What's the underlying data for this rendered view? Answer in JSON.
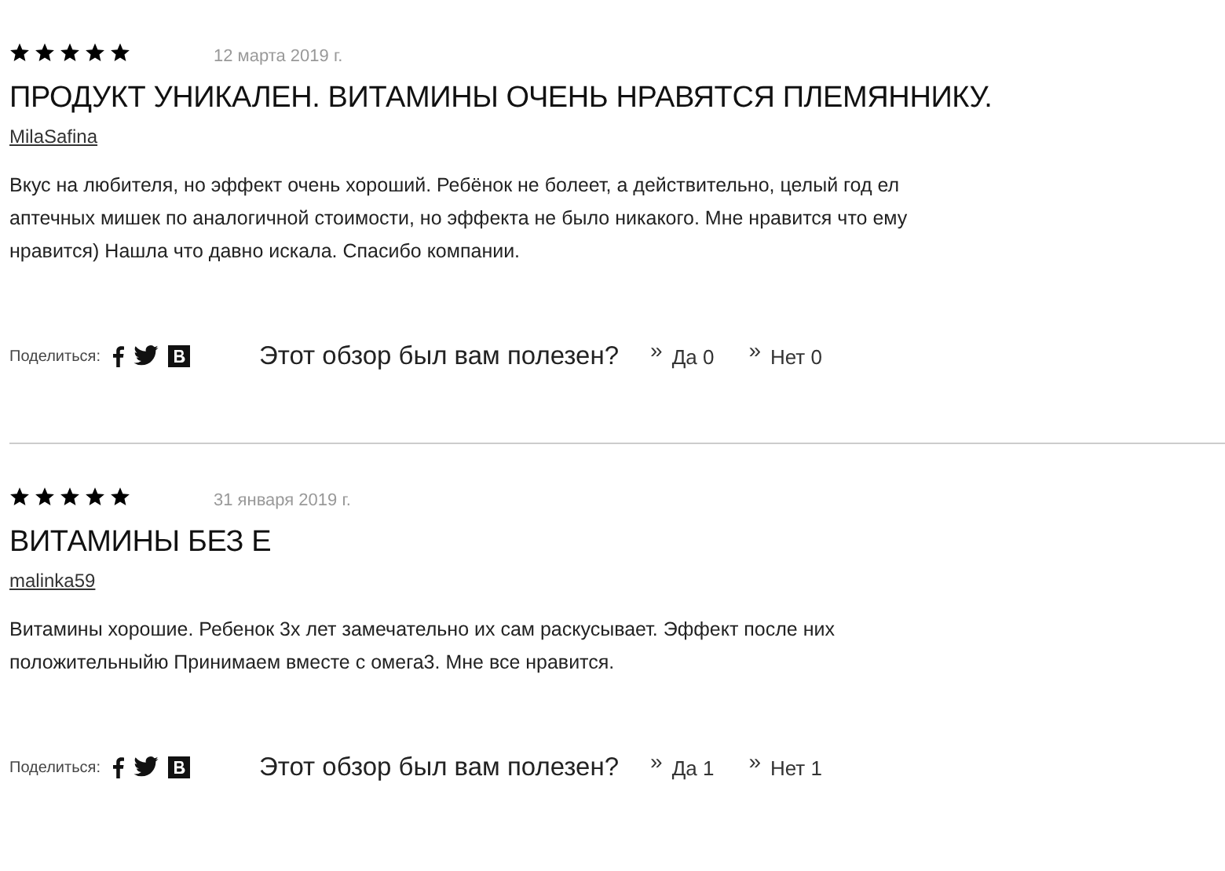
{
  "reviews": [
    {
      "stars": 5,
      "date": "12 марта 2019 г.",
      "title": "ПРОДУКТ УНИКАЛЕН. ВИТАМИНЫ ОЧЕНЬ НРАВЯТСЯ ПЛЕМЯННИКУ.",
      "author": "MilaSafina",
      "body": "Вкус на любителя, но эффект очень хороший. Ребёнок не болеет, а действительно, целый год ел аптечных мишек по аналогичной стоимости, но эффекта не было никакого. Мне нравится что ему нравится) Нашла что давно искала. Спасибо компании.",
      "share_label": "Поделиться:",
      "question": "Этот обзор был вам полезен?",
      "votes": [
        {
          "arrow": "»",
          "label": "Да 0"
        },
        {
          "arrow": "»",
          "label": "Нет 0"
        }
      ]
    },
    {
      "stars": 5,
      "date": "31 января 2019 г.",
      "title": "ВИТАМИНЫ БЕЗ Е",
      "author": "malinka59",
      "body": "Витамины хорошие. Ребенок 3х лет замечательно их сам раскусывает. Эффект после них положительныйю Принимаем вместе с омега3. Мне все нравится.",
      "share_label": "Поделиться:",
      "question": "Этот обзор был вам полезен?",
      "votes": [
        {
          "arrow": "»",
          "label": "Да 1"
        },
        {
          "arrow": "»",
          "label": "Нет 1"
        }
      ]
    }
  ]
}
